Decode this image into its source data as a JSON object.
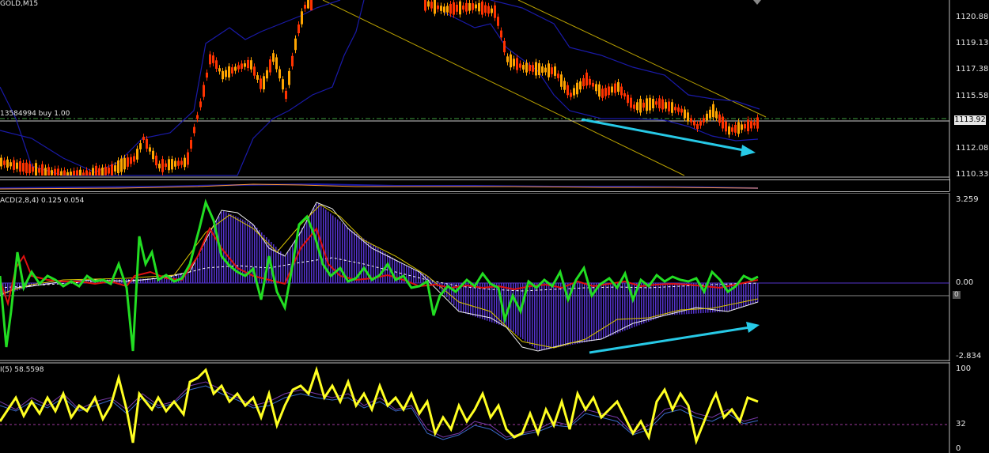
{
  "symbol_label": "GOLD,M15",
  "order_label": "13584994 buy 1.00",
  "price_axis": [
    "1120.88",
    "1119.13",
    "1117.38",
    "1115.58",
    "1112.08",
    "1110.33"
  ],
  "current_price": "1113.92",
  "macd_label": "ACD(2,8,4) 0.125 0.054",
  "macd_axis": {
    "top": "3.259",
    "zero": "0.00",
    "bottom": "-2.834",
    "marker": "0"
  },
  "rsi_label": "I(5) 58.5598",
  "rsi_axis": {
    "top": "100",
    "mid": "32",
    "bottom": "0"
  },
  "colors": {
    "bull_candle": "#ffa500",
    "bear_candle": "#ff3300",
    "bollinger": "#1a1aa8",
    "channel": "#b8a000",
    "arrow": "#27c9e6",
    "macd_fast": "#22dd22",
    "macd_signal": "#e01010",
    "macd_hist": "#5533cc",
    "rsi": "#ffff22",
    "order_line": "#3fa03f"
  }
}
